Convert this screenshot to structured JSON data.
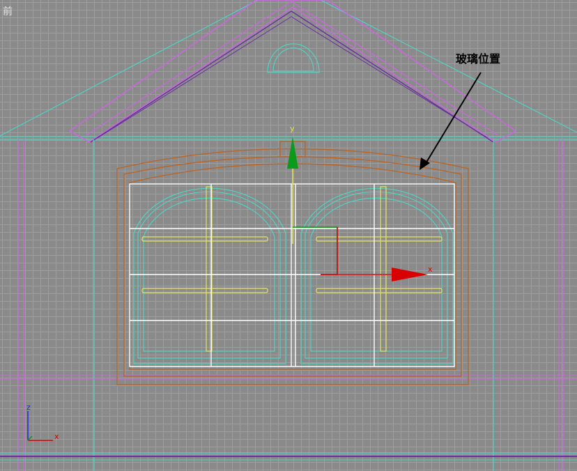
{
  "viewport": {
    "label": "前",
    "annotation": "玻璃位置"
  },
  "gizmo": {
    "x_label": "x",
    "y_label": "y"
  },
  "axis_tripod": {
    "x_label": "x",
    "z_label": "z"
  },
  "colors": {
    "background": "#8a8a8a",
    "grid": "#9e9e9e",
    "cyan": "#4fd3c4",
    "magenta": "#cc66e0",
    "purple": "#6a2fa0",
    "orange": "#b8652a",
    "white": "#ffffff",
    "yellow": "#e6e35c",
    "gizmo_x": "#d80000",
    "gizmo_y": "#0b9a1a"
  }
}
